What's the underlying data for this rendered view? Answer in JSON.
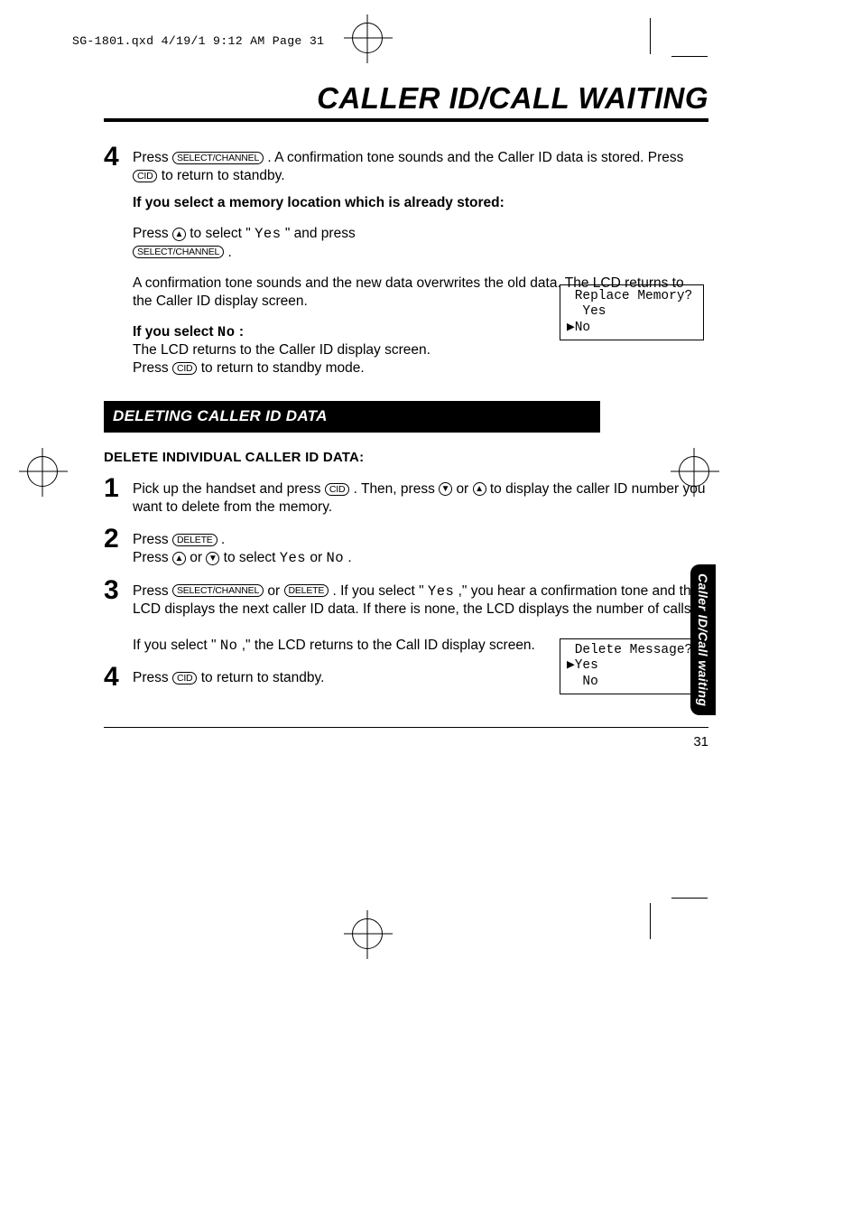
{
  "print_header": "SG-1801.qxd  4/19/1 9:12 AM  Page 31",
  "title": "CALLER ID/CALL WAITING",
  "buttons": {
    "select_channel": "SELECT/CHANNEL",
    "cid": "CID",
    "delete": "DELETE"
  },
  "step4_top": {
    "num": "4",
    "a": "Press ",
    "b": " . A confirmation tone sounds and the Caller ID data is stored. Press ",
    "c": " to return to standby."
  },
  "memloc_heading": "If you select a memory location which is already stored:",
  "memloc_para": {
    "a": "Press ",
    "b": " to select \" ",
    "yes": "Yes",
    "c": " \" and press ",
    "d": " ."
  },
  "lcd1": {
    "l1": " Replace Memory?",
    "l2": "  Yes",
    "l3": "▶No"
  },
  "overwrite_para": "A confirmation tone sounds and the new data overwrites the old data. The LCD returns to\nthe Caller ID display screen.",
  "selectno_heading_a": "If you select ",
  "selectno_heading_no": "No",
  "selectno_heading_b": " :",
  "selectno_para_a": "The LCD returns to the Caller ID display screen.",
  "selectno_para_b1": "Press ",
  "selectno_para_b2": " to return to standby mode.",
  "section_bar": "DELETING CALLER ID DATA",
  "subhead": "DELETE INDIVIDUAL CALLER ID DATA:",
  "d_step1": {
    "num": "1",
    "a": "Pick up the handset and press ",
    "b": " . Then, press ",
    "c": " or ",
    "d": " to display the caller ID number you want to delete from the memory."
  },
  "d_step2": {
    "num": "2",
    "a": "Press ",
    "b": " .",
    "c": "Press ",
    "d": " or ",
    "e": " to select ",
    "yes": "Yes",
    "f": " or ",
    "no": "No",
    "g": "."
  },
  "lcd2": {
    "l1": " Delete Message?",
    "l2": "▶Yes",
    "l3": "  No"
  },
  "d_step3": {
    "num": "3",
    "a": "Press ",
    "b": " or ",
    "c": " .  If you select \" ",
    "yes": "Yes",
    "d": " ,\" you hear a confirmation tone and the LCD displays the next caller ID data. If there is none, the LCD displays the number of calls.",
    "e": "If you select \" ",
    "no": "No",
    "f": " ,\" the LCD returns to the Call ID display screen."
  },
  "d_step4": {
    "num": "4",
    "a": "Press ",
    "b": " to return to standby."
  },
  "tab": "Caller ID/Call waiting",
  "page_number": "31"
}
